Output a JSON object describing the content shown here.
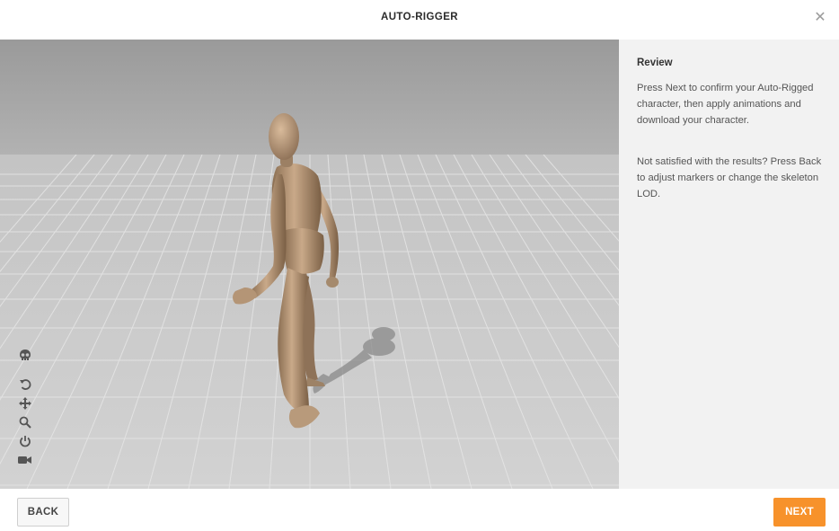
{
  "header": {
    "title": "AUTO-RIGGER",
    "close_icon": "close-icon"
  },
  "viewport": {
    "tools": [
      "skeleton-icon",
      "rotate-icon",
      "pan-icon",
      "zoom-icon",
      "power-icon",
      "camera-icon"
    ]
  },
  "panel": {
    "title": "Review",
    "paragraph1": "Press Next to confirm your Auto-Rigged character, then apply animations and download your character.",
    "paragraph2": "Not satisfied with the results? Press Back to adjust markers or change the skeleton LOD."
  },
  "footer": {
    "back_label": "BACK",
    "next_label": "NEXT"
  },
  "colors": {
    "accent": "#f7922b",
    "panel_bg": "#f2f2f2"
  }
}
